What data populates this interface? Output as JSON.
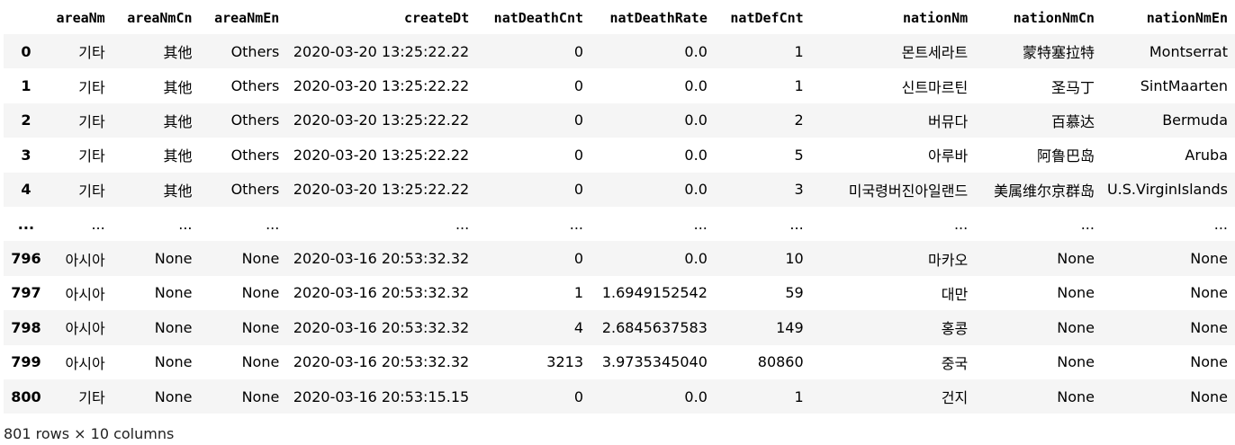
{
  "columns": [
    "",
    "areaNm",
    "areaNmCn",
    "areaNmEn",
    "createDt",
    "natDeathCnt",
    "natDeathRate",
    "natDefCnt",
    "nationNm",
    "nationNmCn",
    "nationNmEn"
  ],
  "rows": [
    [
      "0",
      "기타",
      "其他",
      "Others",
      "2020-03-20 13:25:22.22",
      "0",
      "0.0",
      "1",
      "몬트세라트",
      "蒙特塞拉特",
      "Montserrat"
    ],
    [
      "1",
      "기타",
      "其他",
      "Others",
      "2020-03-20 13:25:22.22",
      "0",
      "0.0",
      "1",
      "신트마르틴",
      "圣马丁",
      "SintMaarten"
    ],
    [
      "2",
      "기타",
      "其他",
      "Others",
      "2020-03-20 13:25:22.22",
      "0",
      "0.0",
      "2",
      "버뮤다",
      "百慕达",
      "Bermuda"
    ],
    [
      "3",
      "기타",
      "其他",
      "Others",
      "2020-03-20 13:25:22.22",
      "0",
      "0.0",
      "5",
      "아루바",
      "阿鲁巴岛",
      "Aruba"
    ],
    [
      "4",
      "기타",
      "其他",
      "Others",
      "2020-03-20 13:25:22.22",
      "0",
      "0.0",
      "3",
      "미국령버진아일랜드",
      "美属维尔京群岛",
      "U.S.VirginIslands"
    ],
    [
      "...",
      "...",
      "...",
      "...",
      "...",
      "...",
      "...",
      "...",
      "...",
      "...",
      "..."
    ],
    [
      "796",
      "아시아",
      "None",
      "None",
      "2020-03-16 20:53:32.32",
      "0",
      "0.0",
      "10",
      "마카오",
      "None",
      "None"
    ],
    [
      "797",
      "아시아",
      "None",
      "None",
      "2020-03-16 20:53:32.32",
      "1",
      "1.6949152542",
      "59",
      "대만",
      "None",
      "None"
    ],
    [
      "798",
      "아시아",
      "None",
      "None",
      "2020-03-16 20:53:32.32",
      "4",
      "2.6845637583",
      "149",
      "홍콩",
      "None",
      "None"
    ],
    [
      "799",
      "아시아",
      "None",
      "None",
      "2020-03-16 20:53:32.32",
      "3213",
      "3.9735345040",
      "80860",
      "중국",
      "None",
      "None"
    ],
    [
      "800",
      "기타",
      "None",
      "None",
      "2020-03-16 20:53:15.15",
      "0",
      "0.0",
      "1",
      "건지",
      "None",
      "None"
    ]
  ],
  "footer": "801 rows × 10 columns"
}
